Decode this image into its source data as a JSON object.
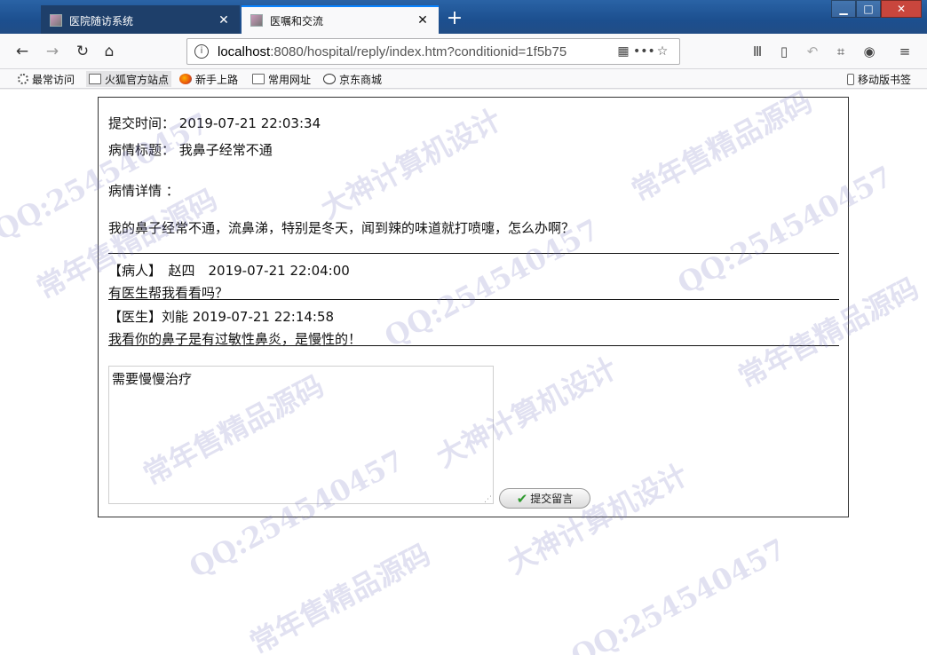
{
  "browser": {
    "tabs": [
      {
        "title": "医院随访系统",
        "active": false
      },
      {
        "title": "医嘱和交流",
        "active": true
      }
    ],
    "url": {
      "host": "localhost",
      "rest": ":8080/hospital/reply/index.htm?conditionid=1f5b75"
    },
    "bookmarks": [
      {
        "label": "最常访问",
        "icon": "gear-icon"
      },
      {
        "label": "火狐官方站点",
        "icon": "folder-icon"
      },
      {
        "label": "新手上路",
        "icon": "firefox-icon"
      },
      {
        "label": "常用网址",
        "icon": "folder-icon"
      },
      {
        "label": "京东商城",
        "icon": "globe-icon"
      }
    ],
    "mobile_bookmarks": "移动版书签"
  },
  "record": {
    "submit_time_label": "提交时间：",
    "submit_time": "2019-07-21 22:03:34",
    "title_label": "病情标题：",
    "title": "我鼻子经常不通",
    "detail_label": "病情详情 ：",
    "detail": "我的鼻子经常不通，流鼻涕，特别是冬天，闻到辣的味道就打喷嚏，怎么办啊？"
  },
  "messages": [
    {
      "header": "【病人】　赵四　2019-07-21 22:04:00",
      "body": "有医生帮我看看吗？"
    },
    {
      "header": "【医生】刘能 2019-07-21 22:14:58",
      "body": "我看你的鼻子是有过敏性鼻炎，是慢性的！"
    }
  ],
  "reply": {
    "value": "需要慢慢治疗",
    "submit_label": "提交留言"
  },
  "watermarks": [
    "常年售精品源码",
    "QQ:254540457",
    "大神计算机设计"
  ]
}
